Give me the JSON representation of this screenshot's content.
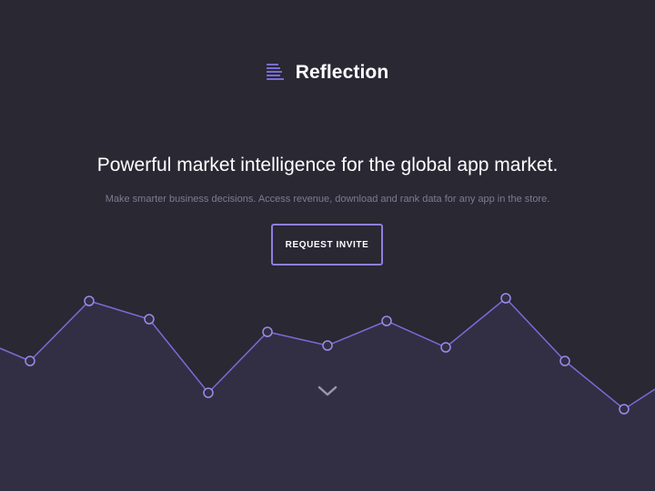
{
  "brand": {
    "name": "Reflection",
    "accent_color": "#7a6bd6"
  },
  "hero": {
    "headline": "Powerful market intelligence for the global app market.",
    "subtitle": "Make smarter business decisions. Access revenue, download and rank data for any app in the store.",
    "cta_label": "REQUEST INVITE"
  },
  "decor_graph": {
    "line_color": "#7a6bd6",
    "fill_color": "#322f45",
    "point_count": 12
  },
  "icons": {
    "logo": "stacked-bars-icon",
    "scroll": "chevron-down-icon"
  }
}
